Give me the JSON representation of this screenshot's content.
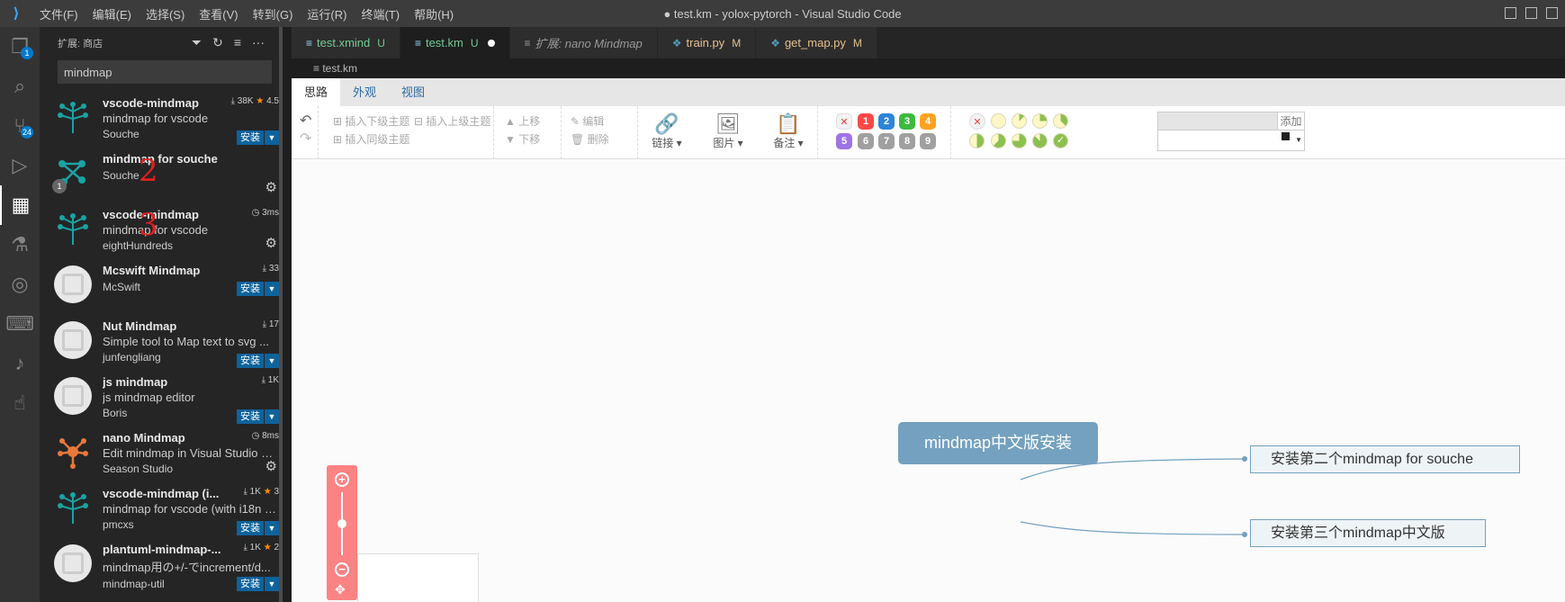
{
  "titlebar": {
    "menu": [
      "文件(F)",
      "编辑(E)",
      "选择(S)",
      "查看(V)",
      "转到(G)",
      "运行(R)",
      "终端(T)",
      "帮助(H)"
    ],
    "title": "● test.km - yolox-pytorch - Visual Studio Code"
  },
  "activity": {
    "explorer_badge": "1",
    "scm_badge": "24"
  },
  "sidebar": {
    "header": "扩展: 商店",
    "search_value": "mindmap",
    "extensions": [
      {
        "name": "vscode-mindmap",
        "desc": "mindmap for vscode",
        "publisher": "Souche",
        "downloads": "38K",
        "rating": "4.5",
        "install": "安装"
      },
      {
        "name": "mindmap for souche",
        "desc": "",
        "publisher": "Souche",
        "annotation": "2",
        "version_badge": "1"
      },
      {
        "name": "vscode-mindmap",
        "desc": "mindmap for vscode",
        "publisher": "eightHundreds",
        "time": "3ms",
        "annotation": "3"
      },
      {
        "name": "Mcswift Mindmap",
        "desc": "",
        "publisher": "McSwift",
        "downloads": "33",
        "install": "安装"
      },
      {
        "name": "Nut Mindmap",
        "desc": "Simple tool to Map text to svg ...",
        "publisher": "junfengliang",
        "downloads": "17",
        "install": "安装"
      },
      {
        "name": "js mindmap",
        "desc": "js mindmap editor",
        "publisher": "Boris",
        "downloads": "1K",
        "install": "安装"
      },
      {
        "name": "nano Mindmap",
        "desc": "Edit mindmap in Visual Studio C...",
        "publisher": "Season Studio",
        "time": "8ms"
      },
      {
        "name": "vscode-mindmap (i...",
        "desc": "mindmap for vscode (with i18n s...",
        "publisher": "pmcxs",
        "downloads": "1K",
        "rating": "3",
        "install": "安装"
      },
      {
        "name": "plantuml-mindmap-...",
        "desc": "mindmap用の+/-でincrement/d...",
        "publisher": "mindmap-util",
        "downloads": "1K",
        "rating": "2",
        "install": "安装"
      }
    ]
  },
  "tabs": [
    {
      "label": "test.xmind",
      "status": "U",
      "active": false,
      "italic": false
    },
    {
      "label": "test.km",
      "status": "U",
      "active": true,
      "dirty": true
    },
    {
      "label": "扩展: nano Mindmap",
      "status": "",
      "active": false,
      "italic": true
    },
    {
      "label": "train.py",
      "status": "M",
      "active": false
    },
    {
      "label": "get_map.py",
      "status": "M",
      "active": false
    }
  ],
  "breadcrumb": "test.km",
  "km": {
    "tabs": [
      "思路",
      "外观",
      "视图"
    ],
    "toolbar": {
      "insert_child": "插入下级主题",
      "insert_parent": "插入上级主题",
      "insert_sibling": "插入同级主题",
      "move_up": "上移",
      "move_down": "下移",
      "edit": "编辑",
      "delete": "删除",
      "link": "链接",
      "image": "图片",
      "note": "备注",
      "add": "添加"
    },
    "priorities": [
      "1",
      "2",
      "3",
      "4",
      "5",
      "6",
      "7",
      "8",
      "9"
    ],
    "priority_colors": [
      "#ff4747",
      "#2e84d8",
      "#3dba3d",
      "#ffa322",
      "#9d73e6",
      "#a0a0a0",
      "#a0a0a0",
      "#a0a0a0",
      "#a0a0a0"
    ],
    "root": "mindmap中文版安装",
    "children": [
      "安装第二个mindmap for souche",
      "安装第三个mindmap中文版"
    ]
  }
}
